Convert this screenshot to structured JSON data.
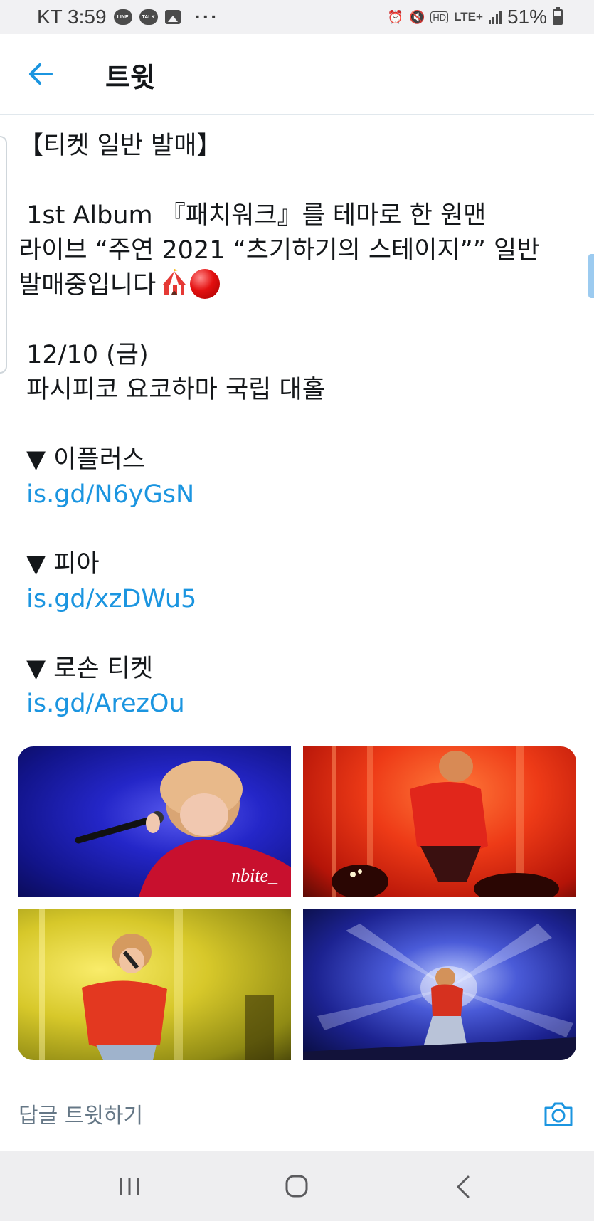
{
  "status_bar": {
    "carrier_time": "KT 3:59",
    "notif_line": "LINE",
    "notif_talk": "TALK",
    "more": "···",
    "network": "LTE+",
    "hd": "HD",
    "battery": "51%"
  },
  "header": {
    "title": "트윗"
  },
  "tweet": {
    "lines": [
      "【티켓 일반 발매】",
      "",
      " 1st Album 『패치워크』를 테마로 한 원맨",
      "라이브 “주연 2021 “츠기하기의 스테이지”” 일반",
      "발매중입니다",
      "",
      " 12/10 (금)",
      " 파시피코 요코하마 국립 대홀",
      "",
      " ▼ 이플러스",
      " is.gd/N6yGsN",
      "",
      " ▼ 피아",
      " is.gd/xzDWu5",
      "",
      " ▼ 로손 티켓",
      " is.gd/ArezOu"
    ],
    "emojis": [
      "circus-tent-emoji",
      "red-ball-emoji"
    ],
    "photos": [
      {
        "name": "photo-blue-singer",
        "dominant": "#2426c8"
      },
      {
        "name": "photo-red-stage",
        "dominant": "#ee3b17"
      },
      {
        "name": "photo-yellow-stage",
        "dominant": "#d7c82a"
      },
      {
        "name": "photo-blue-lights",
        "dominant": "#1c2290"
      }
    ]
  },
  "reply": {
    "placeholder": "답글 트윗하기"
  },
  "colors": {
    "accent": "#1b95e0",
    "text": "#14171a",
    "muted": "#657786"
  }
}
